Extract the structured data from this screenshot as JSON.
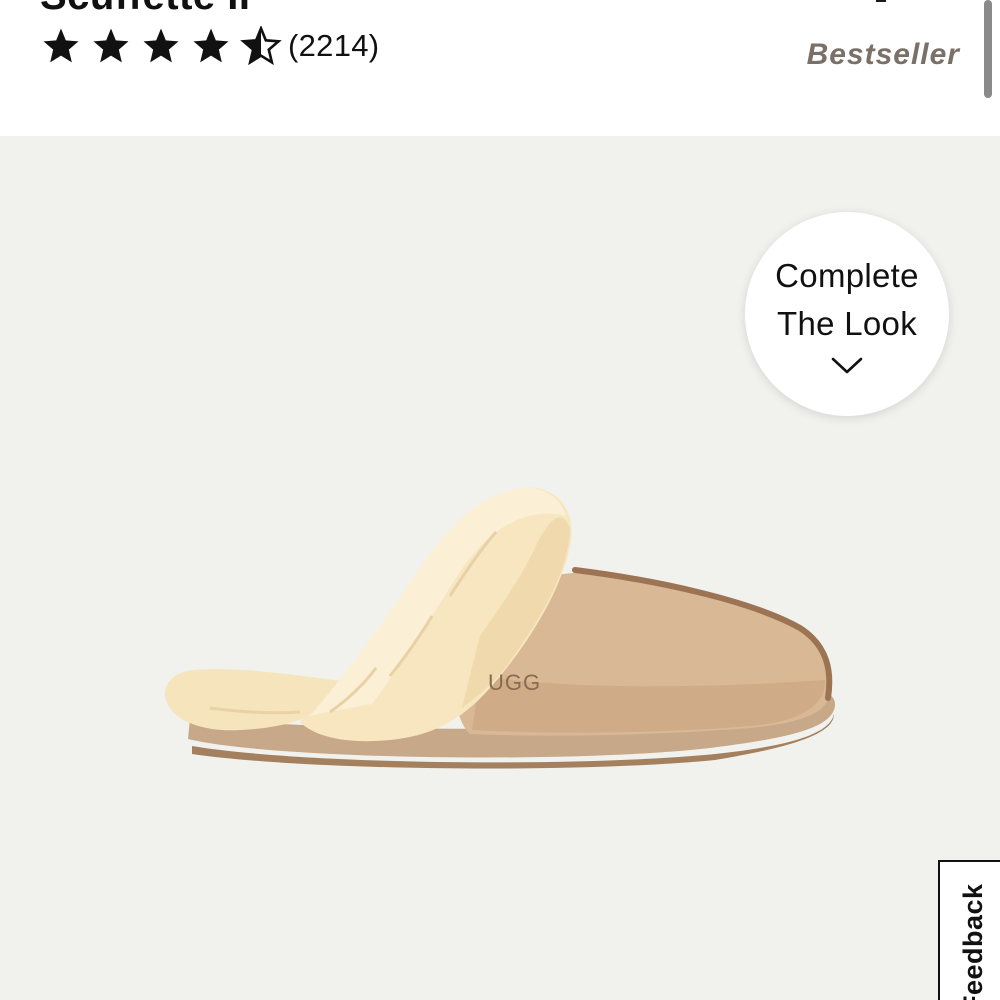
{
  "product": {
    "title": "Scuffette II",
    "rating": {
      "value": 4.5,
      "max": 5,
      "review_count_label": "(2214)"
    },
    "badge": "Bestseller",
    "image": {
      "brand_logo_text": "UGG",
      "alt": "UGG Scuffette II slipper"
    }
  },
  "complete_the_look": {
    "line1": "Complete",
    "line2": "The Look",
    "icon": "chevron-down-icon"
  },
  "feedback_tab": {
    "label": "Feedback"
  },
  "colors": {
    "badge_text": "#7a7068",
    "gallery_background": "#f1f1ee",
    "star_fill": "#111111"
  }
}
